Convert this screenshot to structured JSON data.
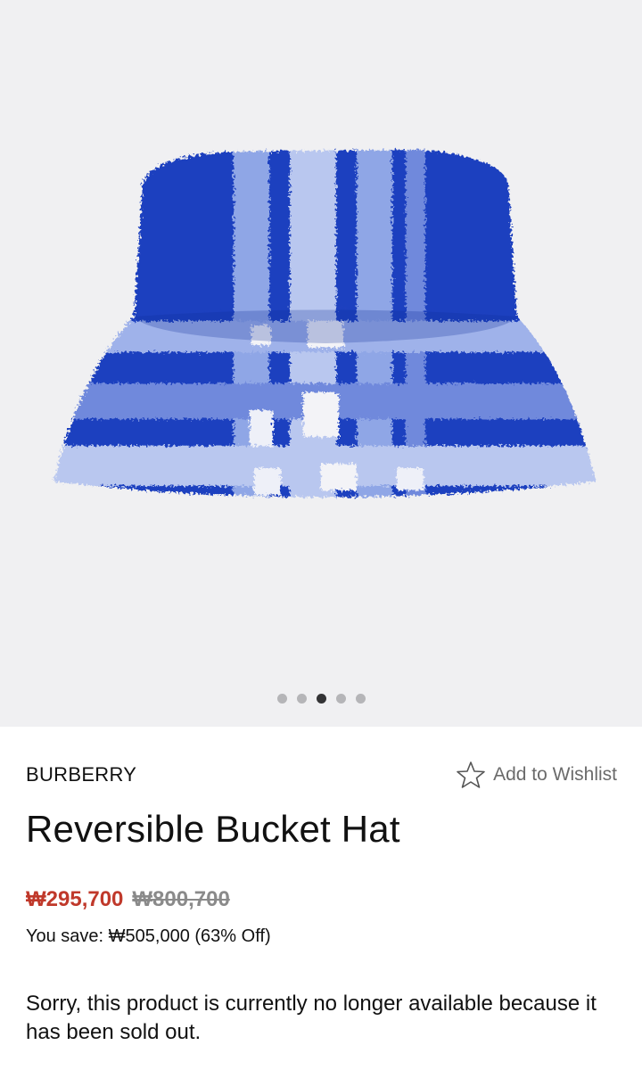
{
  "gallery": {
    "image_alt": "Blue check fleece bucket hat",
    "slide_count": 5,
    "active_slide": 3,
    "colors": {
      "background": "#f0f0f2",
      "hat_blue": "#1f3fbf",
      "dot_active": "#333335",
      "dot_inactive": "#b5b5b8"
    }
  },
  "product": {
    "brand": "BURBERRY",
    "wishlist_label": "Add to Wishlist",
    "title": "Reversible Bucket Hat",
    "sale_price": "₩295,700",
    "original_price": "₩800,700",
    "savings": "You save: ₩505,000 (63% Off)",
    "availability": "Sorry, this product is currently no longer available because it has been sold out.",
    "colors": {
      "sale_price": "#c0392b",
      "original_price": "#8a8a8a"
    }
  }
}
